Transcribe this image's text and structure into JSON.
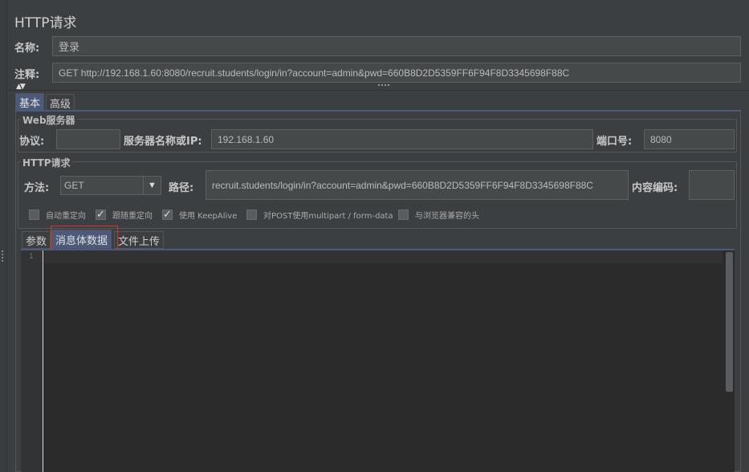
{
  "title": "HTTP请求",
  "name_label": "名称:",
  "name_value": "登录",
  "comment_label": "注释:",
  "comment_value": "GET http://192.168.1.60:8080/recruit.students/login/in?account=admin&pwd=660B8D2D5359FF6F94F8D3345698F88C",
  "main_tabs": [
    {
      "label": "基本",
      "selected": true
    },
    {
      "label": "高级",
      "selected": false
    }
  ],
  "web_server": {
    "legend": "Web服务器",
    "protocol_label": "协议:",
    "protocol_value": "",
    "server_label": "服务器名称或IP:",
    "server_value": "192.168.1.60",
    "port_label": "端口号:",
    "port_value": "8080"
  },
  "http_request": {
    "legend": "HTTP请求",
    "method_label": "方法:",
    "method_value": "GET",
    "path_label": "路径:",
    "path_value": "recruit.students/login/in?account=admin&pwd=660B8D2D5359FF6F94F8D3345698F88C",
    "encoding_label": "内容编码:",
    "encoding_value": ""
  },
  "checkboxes": [
    {
      "label": "自动重定向",
      "checked": false
    },
    {
      "label": "跟随重定向",
      "checked": true
    },
    {
      "label": "使用 KeepAlive",
      "checked": true
    },
    {
      "label": "对POST使用multipart / form-data",
      "checked": false
    },
    {
      "label": "与浏览器兼容的头",
      "checked": false
    }
  ],
  "sub_tabs": [
    {
      "label": "参数",
      "selected": false
    },
    {
      "label": "消息体数据",
      "selected": true
    },
    {
      "label": "文件上传",
      "selected": false
    }
  ],
  "editor": {
    "line_numbers": [
      "1"
    ]
  },
  "highlight_color": "#e03030"
}
